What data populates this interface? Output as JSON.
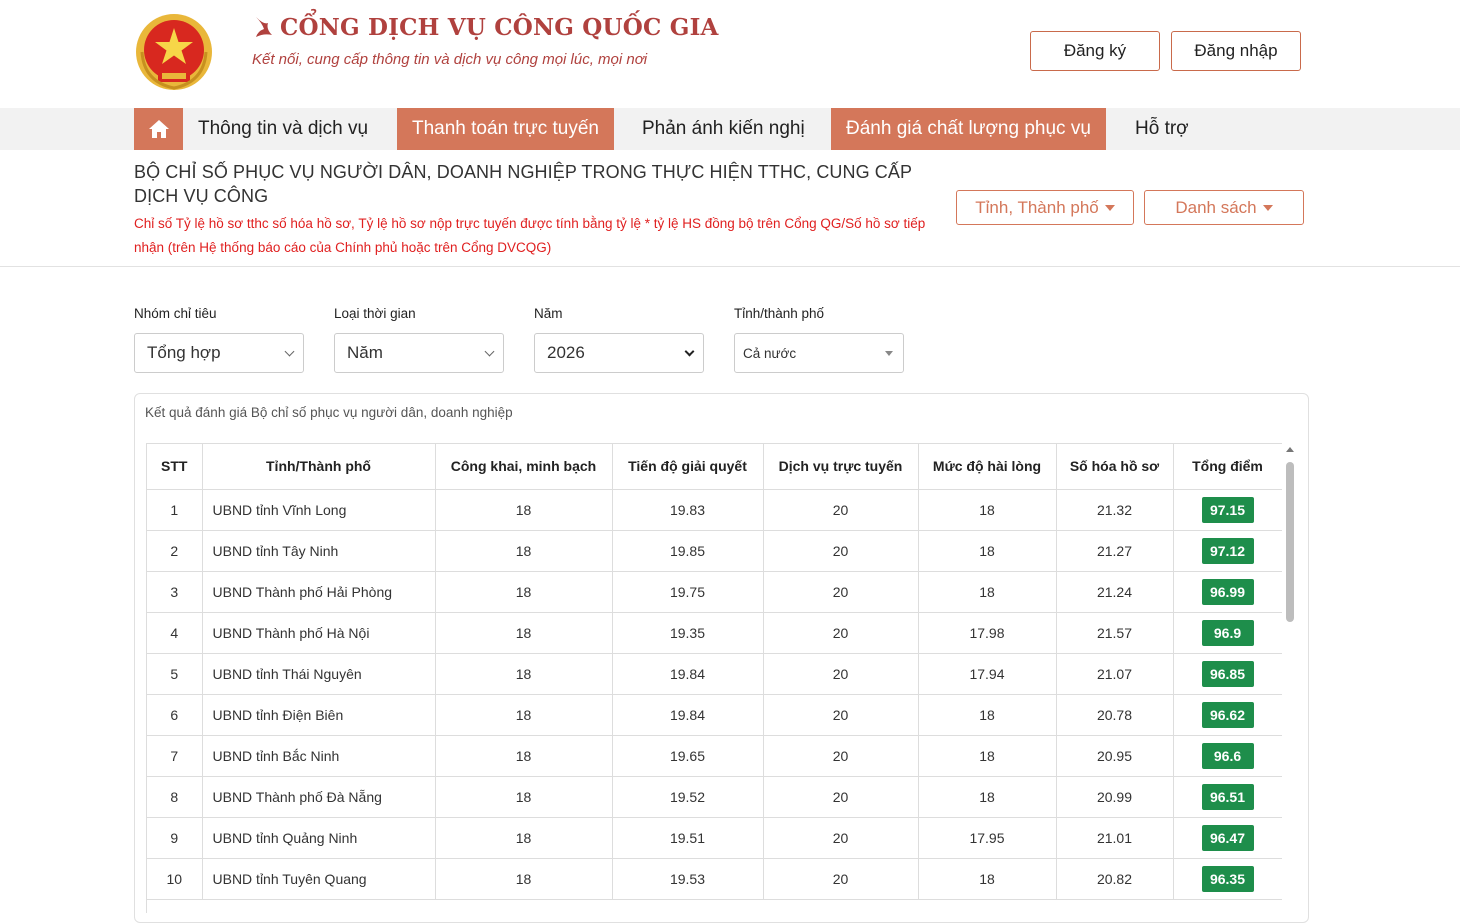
{
  "header": {
    "brand_title": "CỔNG DỊCH VỤ CÔNG QUỐC GIA",
    "brand_subtitle": "Kết nối, cung cấp thông tin và dịch vụ công mọi lúc, mọi nơi",
    "register_label": "Đăng ký",
    "login_label": "Đăng nhập"
  },
  "nav": {
    "items": [
      {
        "label": "Thông tin và dịch vụ"
      },
      {
        "label": "Thanh toán trực tuyến"
      },
      {
        "label": "Phản ánh kiến nghị"
      },
      {
        "label": "Đánh giá chất lượng phục vụ"
      },
      {
        "label": "Hỗ trợ"
      }
    ]
  },
  "page": {
    "title": "Bộ chỉ số phục vụ người dân, doanh nghiệp trong thực hiện TTHC, cung cấp dịch vụ công",
    "note": "Chỉ số Tỷ lệ hồ sơ tthc số hóa hồ sơ, Tỷ lệ hồ sơ nộp trực tuyến được tính bằng tỷ lệ * tỷ lệ HS đồng bộ trên Cổng QG/Số hồ sơ tiếp nhận (trên Hệ thống báo cáo của Chính phủ hoặc trên Cổng DVCQG)",
    "province_dropdown": "Tỉnh, Thành phố",
    "list_dropdown": "Danh sách"
  },
  "filters": {
    "group": {
      "label": "Nhóm chỉ tiêu",
      "value": "Tổng hợp"
    },
    "time_type": {
      "label": "Loại thời gian",
      "value": "Năm"
    },
    "year": {
      "label": "Năm",
      "value": "2026"
    },
    "province": {
      "label": "Tỉnh/thành phố",
      "value": "Cả nước"
    }
  },
  "results": {
    "caption": "Kết quả đánh giá Bộ chỉ số phục vụ người dân, doanh nghiệp",
    "columns": [
      "STT",
      "Tỉnh/Thành phố",
      "Công khai, minh bạch",
      "Tiến độ giải quyết",
      "Dịch vụ trực tuyến",
      "Mức độ hài lòng",
      "Số hóa hồ sơ",
      "Tổng điểm"
    ],
    "rows": [
      [
        "1",
        "UBND tỉnh Vĩnh Long",
        "18",
        "19.83",
        "20",
        "18",
        "21.32",
        "97.15"
      ],
      [
        "2",
        "UBND tỉnh Tây Ninh",
        "18",
        "19.85",
        "20",
        "18",
        "21.27",
        "97.12"
      ],
      [
        "3",
        "UBND Thành phố Hải Phòng",
        "18",
        "19.75",
        "20",
        "18",
        "21.24",
        "96.99"
      ],
      [
        "4",
        "UBND Thành phố Hà Nội",
        "18",
        "19.35",
        "20",
        "17.98",
        "21.57",
        "96.9"
      ],
      [
        "5",
        "UBND tỉnh Thái Nguyên",
        "18",
        "19.84",
        "20",
        "17.94",
        "21.07",
        "96.85"
      ],
      [
        "6",
        "UBND tỉnh Điện Biên",
        "18",
        "19.84",
        "20",
        "18",
        "20.78",
        "96.62"
      ],
      [
        "7",
        "UBND tỉnh Bắc Ninh",
        "18",
        "19.65",
        "20",
        "18",
        "20.95",
        "96.6"
      ],
      [
        "8",
        "UBND Thành phố Đà Nẵng",
        "18",
        "19.52",
        "20",
        "18",
        "20.99",
        "96.51"
      ],
      [
        "9",
        "UBND tỉnh Quảng Ninh",
        "18",
        "19.51",
        "20",
        "17.95",
        "21.01",
        "96.47"
      ],
      [
        "10",
        "UBND tỉnh Tuyên Quang",
        "18",
        "19.53",
        "20",
        "18",
        "20.82",
        "96.35"
      ]
    ]
  },
  "colors": {
    "accent": "#d4775a",
    "brand": "#b0413e",
    "score_badge": "#1e8e4b",
    "note_red": "#e02020"
  }
}
